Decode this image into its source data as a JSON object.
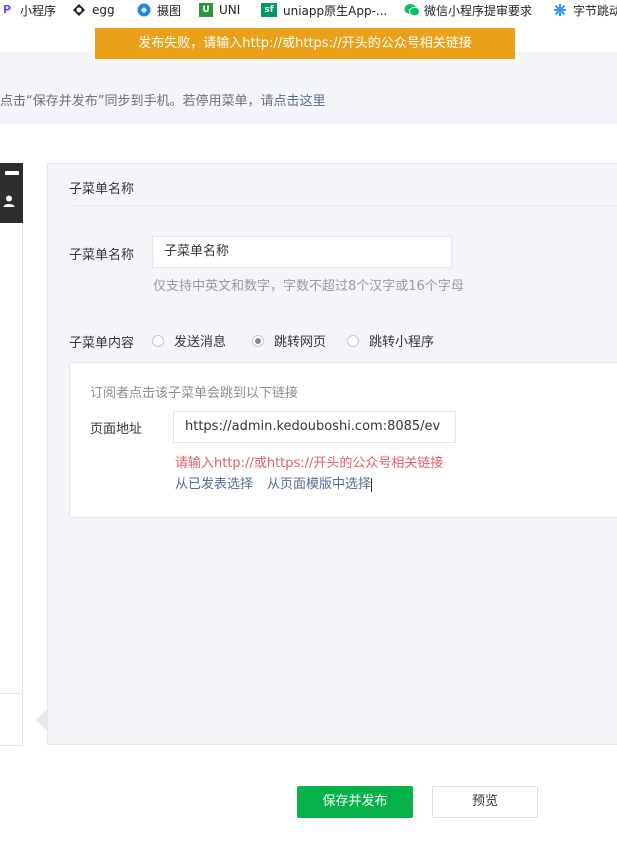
{
  "bookmarks": [
    {
      "label": "小程序",
      "icon": "letter-p-icon",
      "color": "#6a4cff"
    },
    {
      "label": "egg",
      "icon": "egg-logo-icon",
      "color": "#222222"
    },
    {
      "label": "摄图",
      "icon": "sheitu-logo-icon",
      "color": "#1e88e5"
    },
    {
      "label": "UNI",
      "icon": "uni-logo-icon",
      "color": "#2b9939"
    },
    {
      "label": "uniapp原生App-...",
      "icon": "sf-logo-icon",
      "color": "#009a61"
    },
    {
      "label": "微信小程序提审要求",
      "icon": "wechat-icon",
      "color": "#07c160"
    },
    {
      "label": "字节跳动",
      "icon": "bytedance-icon",
      "color": "#3296fa"
    }
  ],
  "toast": {
    "text": "发布失败，请输入http://或https://开头的公众号相关链接",
    "color": "#e9a11a"
  },
  "notice": {
    "text_prefix": "点击“保存并发布”同步到手机。若停用菜单，请",
    "link": "点击这里"
  },
  "editor": {
    "title": "子菜单名称",
    "name_label": "子菜单名称",
    "name_value": "子菜单名称",
    "name_hint": "仅支持中英文和数字，字数不超过8个汉字或16个字母",
    "content_label": "子菜单内容",
    "options": [
      {
        "label": "发送消息",
        "selected": false
      },
      {
        "label": "跳转网页",
        "selected": true
      },
      {
        "label": "跳转小程序",
        "selected": false
      }
    ],
    "box": {
      "hint": "订阅者点击该子菜单会跳到以下链接",
      "url_label": "页面地址",
      "url_value": "https://admin.kedouboshi.com:8085/ev",
      "error": "请输入http://或https://开头的公众号相关链接",
      "link_published": "从已发表选择",
      "link_template": "从页面模版中选择"
    }
  },
  "buttons": {
    "save_publish": "保存并发布",
    "preview": "预览"
  },
  "colors": {
    "primary": "#07b24b",
    "error": "#e15f63",
    "link": "#576b95"
  }
}
